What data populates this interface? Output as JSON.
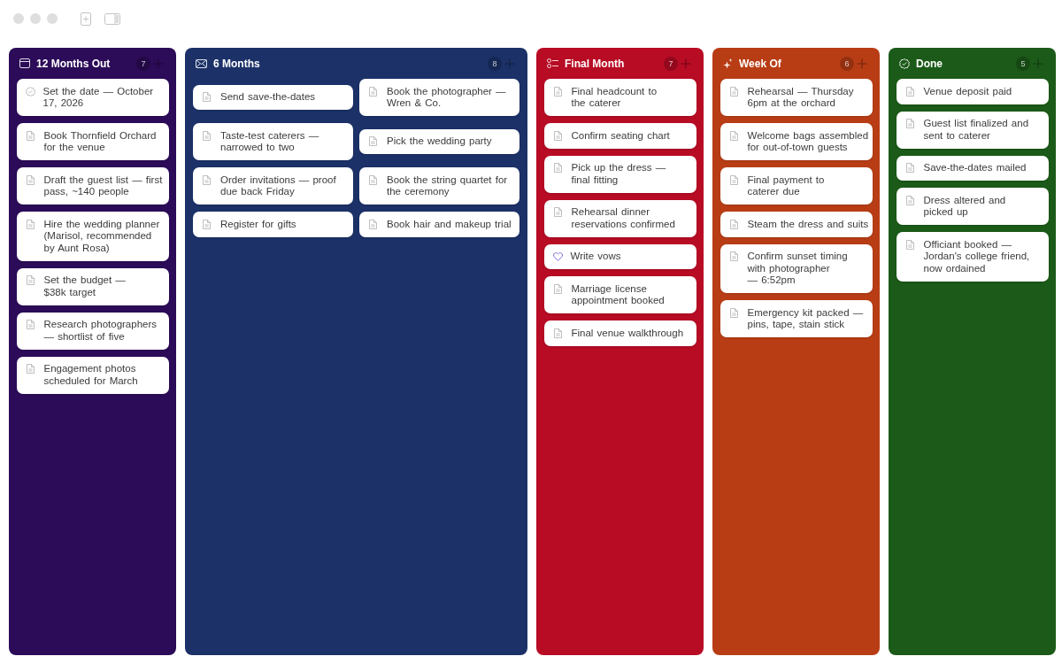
{
  "columns": [
    {
      "title": "12 Months Out",
      "kind": "calendar",
      "color": "#2c0b58",
      "count": "7",
      "wide": false,
      "cards": [
        {
          "text": "Set the date — October 17, 2026",
          "kind": "milestone"
        },
        {
          "text": "Book Thornfield Orchard for the venue",
          "kind": "note"
        },
        {
          "text": "Draft the guest list — first pass, ~140 people",
          "kind": "note"
        },
        {
          "text": "Hire the wedding planner (Marisol, recommended by Aunt Rosa)",
          "kind": "note"
        },
        {
          "text": "Set the budget — $38k target",
          "kind": "note"
        },
        {
          "text": "Research photographers — shortlist of five",
          "kind": "note"
        },
        {
          "text": "Engagement photos scheduled for March",
          "kind": "note"
        }
      ]
    },
    {
      "title": "6 Months",
      "kind": "mail",
      "color": "#1b3168",
      "count": "8",
      "wide": true,
      "cards": [
        {
          "text": "Send save-the-dates",
          "kind": "note"
        },
        {
          "text": "Book the photographer — Wren & Co.",
          "kind": "note"
        },
        {
          "text": "Taste-test caterers — narrowed to two",
          "kind": "note"
        },
        {
          "text": "Pick the wedding party",
          "kind": "note"
        },
        {
          "text": "Order invitations — proof due back Friday",
          "kind": "note"
        },
        {
          "text": "Book the string quartet for the ceremony",
          "kind": "note"
        },
        {
          "text": "Register for gifts",
          "kind": "note"
        },
        {
          "text": "Book hair and makeup trial",
          "kind": "note"
        }
      ]
    },
    {
      "title": "Final Month",
      "kind": "checklist",
      "color": "#b80b24",
      "count": "7",
      "wide": false,
      "cards": [
        {
          "text": "Final headcount to the caterer",
          "kind": "note"
        },
        {
          "text": "Confirm seating chart",
          "kind": "note"
        },
        {
          "text": "Pick up the dress — final fitting",
          "kind": "note"
        },
        {
          "text": "Rehearsal dinner reservations confirmed",
          "kind": "note"
        },
        {
          "text": "Write vows",
          "kind": "heart"
        },
        {
          "text": "Marriage license appointment booked",
          "kind": "note"
        },
        {
          "text": "Final venue walkthrough",
          "kind": "note"
        }
      ]
    },
    {
      "title": "Week Of",
      "kind": "sparkle",
      "color": "#b83d15",
      "count": "6",
      "wide": false,
      "cards": [
        {
          "text": "Rehearsal — Thursday 6pm at the orchard",
          "kind": "note"
        },
        {
          "text": "Welcome bags assembled for out-of-town guests",
          "kind": "note"
        },
        {
          "text": "Final payment to caterer due",
          "kind": "note"
        },
        {
          "text": "Steam the dress and suits",
          "kind": "note"
        },
        {
          "text": "Confirm sunset timing with photographer — 6:52pm",
          "kind": "note"
        },
        {
          "text": "Emergency kit packed — pins, tape, stain stick",
          "kind": "note"
        }
      ]
    },
    {
      "title": "Done",
      "kind": "done",
      "color": "#1b5a18",
      "count": "5",
      "wide": false,
      "cards": [
        {
          "text": "Venue deposit paid",
          "kind": "note"
        },
        {
          "text": "Guest list finalized and sent to caterer",
          "kind": "note"
        },
        {
          "text": "Save-the-dates mailed",
          "kind": "note"
        },
        {
          "text": "Dress altered and picked up",
          "kind": "note"
        },
        {
          "text": "Officiant booked — Jordan's college friend, now ordained",
          "kind": "note"
        }
      ]
    }
  ]
}
